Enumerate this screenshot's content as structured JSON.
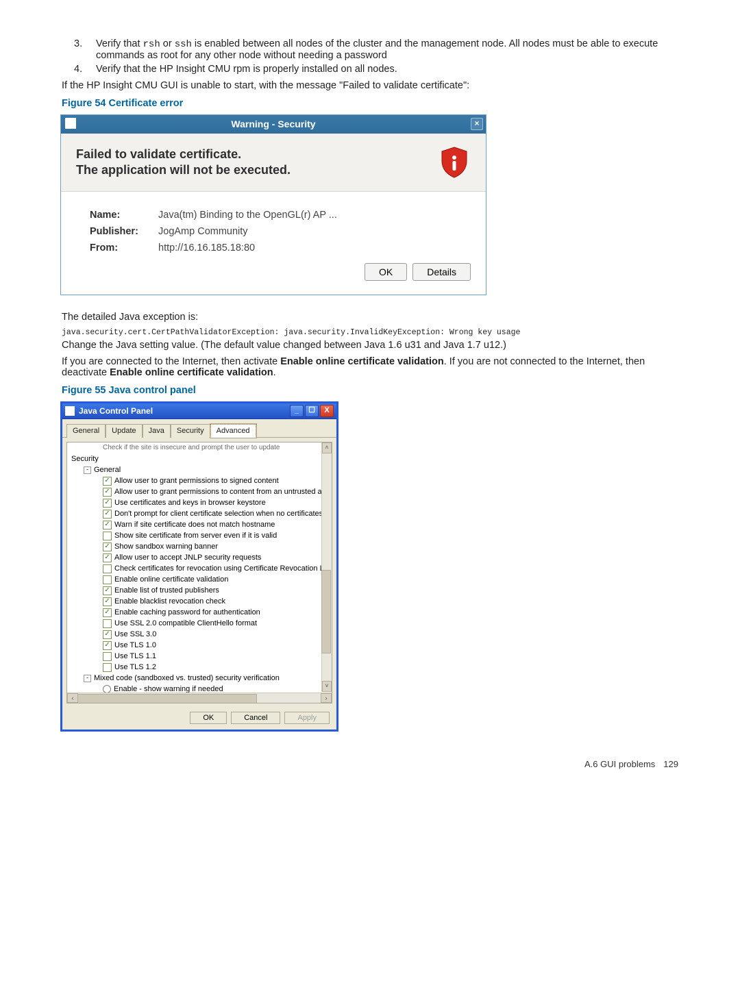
{
  "list": {
    "item3_num": "3.",
    "item3_a": "Verify that ",
    "item3_code1": "rsh",
    "item3_b": " or ",
    "item3_code2": "ssh",
    "item3_c": " is enabled between all nodes of the cluster and the management node. All nodes must be able to execute commands as root for any other node without needing a password",
    "item4_num": "4.",
    "item4": "Verify that the HP Insight CMU rpm is properly installed on all nodes."
  },
  "para_after_list": "If the HP Insight CMU GUI is unable to start, with the message \"Failed to validate certificate\":",
  "fig54_title": "Figure 54 Certificate error",
  "dlg54": {
    "title": "Warning - Security",
    "close_glyph": "×",
    "headline1": "Failed to validate certificate.",
    "headline2": "The application will not be executed.",
    "name_label": "Name:",
    "name_value": "Java(tm) Binding to the OpenGL(r) AP ...",
    "pub_label": "Publisher:",
    "pub_value": "JogAmp Community",
    "from_label": "From:",
    "from_value": "http://16.16.185.18:80",
    "ok": "OK",
    "details": "Details"
  },
  "after_fig54_1": "The detailed Java exception is:",
  "exception": "java.security.cert.CertPathValidatorException: java.security.InvalidKeyException: Wrong key usage",
  "after_fig54_2": "Change the Java setting value. (The default value changed between Java 1.6 u31 and Java 1.7 u12.)",
  "after_fig54_3a": "If you are connected to the Internet, then activate ",
  "bold_enable": "Enable online certificate validation",
  "after_fig54_3b": ". If you are not connected to the Internet, then deactivate ",
  "after_fig54_3c": ".",
  "fig55_title": "Figure 55 Java control panel",
  "jcp": {
    "title": "Java Control Panel",
    "win_min": "_",
    "win_max": "☐",
    "win_close": "X",
    "tabs": [
      "General",
      "Update",
      "Java",
      "Security",
      "Advanced"
    ],
    "active_tab": 4,
    "cut_line": "Check if the site is insecure and prompt the user to update",
    "root_security": "Security",
    "node_general": "General",
    "options": [
      {
        "checked": true,
        "label": "Allow user to grant permissions to signed content"
      },
      {
        "checked": true,
        "label": "Allow user to grant permissions to content from an untrusted authority"
      },
      {
        "checked": true,
        "label": "Use certificates and keys in browser keystore"
      },
      {
        "checked": true,
        "label": "Don't prompt for client certificate selection when no certificates or only"
      },
      {
        "checked": true,
        "label": "Warn if site certificate does not match hostname"
      },
      {
        "checked": false,
        "label": "Show site certificate from server even if it is valid"
      },
      {
        "checked": true,
        "label": "Show sandbox warning banner"
      },
      {
        "checked": true,
        "label": "Allow user to accept JNLP security requests"
      },
      {
        "checked": false,
        "label": "Check certificates for revocation using Certificate Revocation Lists (CR"
      },
      {
        "checked": false,
        "label": "Enable online certificate validation"
      },
      {
        "checked": true,
        "label": "Enable list of trusted publishers"
      },
      {
        "checked": true,
        "label": "Enable blacklist revocation check"
      },
      {
        "checked": true,
        "label": "Enable caching password for authentication"
      },
      {
        "checked": false,
        "label": "Use SSL 2.0 compatible ClientHello format"
      },
      {
        "checked": true,
        "label": "Use SSL 3.0"
      },
      {
        "checked": true,
        "label": "Use TLS 1.0"
      },
      {
        "checked": false,
        "label": "Use TLS 1.1"
      },
      {
        "checked": false,
        "label": "Use TLS 1.2"
      }
    ],
    "mixed_code": "Mixed code (sandboxed vs. trusted) security verification",
    "mixed_radio": "Enable - show warning if needed",
    "ok": "OK",
    "cancel": "Cancel",
    "apply": "Apply"
  },
  "footer_section": "A.6 GUI problems",
  "footer_page": "129",
  "glyphs": {
    "check": "✓",
    "left": "‹",
    "right": "›",
    "up": "˄",
    "down": "˅"
  }
}
